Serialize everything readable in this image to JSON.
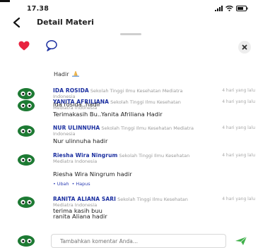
{
  "status": {
    "time": "17.38"
  },
  "header": {
    "title": "Detail Materi"
  },
  "top_comment_tail": {
    "text": "Hadir"
  },
  "comments": [
    {
      "name": "IDA ROSIDA",
      "org": "Sekolah Tinggi Ilmu Kesehatan Mediatra Indonesia",
      "time": "4 hari yang lalu",
      "text": "Ida rosida..hadir"
    },
    {
      "name": "YANITA AFRILIANA",
      "org": "Sekolah Tinggi Ilmu Kesehatan Mediatra Indonesia",
      "time": "4 hari yang lalu",
      "text": "Terimakasih Bu..Yanita Afriliana Hadir"
    },
    {
      "name": "NUR ULINNUHA",
      "org": "Sekolah Tinggi Ilmu Kesehatan Mediatra Indonesia",
      "time": "4 hari yang lalu",
      "text": "Nur ulinnuha hadir"
    },
    {
      "name": "Riesha Wira Ningrum",
      "org": "Sekolah Tinggi Ilmu Kesehatan Mediatra Indonesia",
      "time": "4 hari yang lalu",
      "text": "Riesha Wira Ningrum hadir",
      "actions": {
        "edit": "• Ubah",
        "delete": "• Hapus"
      }
    },
    {
      "name": "RANITA ALIANA SARI",
      "org": "Sekolah Tinggi Ilmu Kesehatan Mediatra Indonesia",
      "time": "4 hari yang lalu",
      "text_line1": "terima kasih buu",
      "text_line2": "ranita Aliana hadir"
    }
  ],
  "composer": {
    "placeholder": "Tambahkan komentar Anda..."
  },
  "colors": {
    "accent": "#1b2fa0",
    "heart": "#e8233f",
    "send": "#3fb04a",
    "avatar": "#1d7a33"
  }
}
